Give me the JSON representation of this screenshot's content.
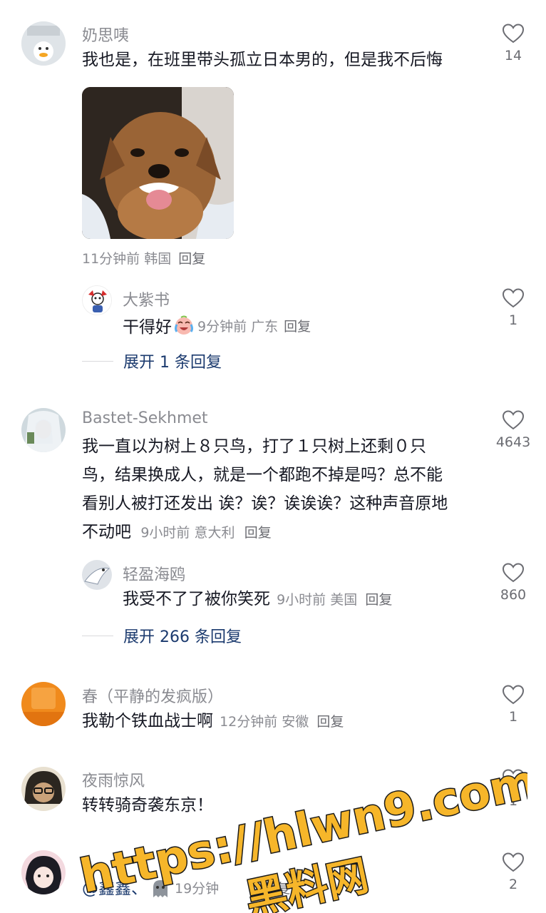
{
  "comments": [
    {
      "username": "奶思咦",
      "text": "我也是，在班里带头孤立日本男的，但是我不后悔",
      "meta": "11分钟前 韩国",
      "reply_label": "回复",
      "likes": "14",
      "sticker": "grinning-dog-sticker",
      "replies": [
        {
          "username": "大紫书",
          "text": "干得好",
          "emoji": "crying-laughing-emoji",
          "meta": "9分钟前 广东",
          "reply_label": "回复",
          "likes": "1"
        }
      ],
      "expand_label": "展开 1 条回复"
    },
    {
      "username": "Bastet-Sekhmet",
      "text_lines": [
        "我一直以为树上８只鸟，打了１只树上还剩０只",
        "鸟，结果换成人，就是一个都跑不掉是吗？总不能",
        "看别人被打还发出 诶？诶？诶诶诶？这种声音原地",
        "不动吧"
      ],
      "meta": "9小时前 意大利",
      "reply_label": "回复",
      "likes": "4643",
      "replies": [
        {
          "username": "轻盈海鸥",
          "text": "我受不了了被你笑死",
          "meta": "9小时前 美国",
          "reply_label": "回复",
          "likes": "860"
        }
      ],
      "expand_label": "展开 266 条回复"
    },
    {
      "username": "春（平静的发疯版）",
      "text": "我勒个铁血战士啊",
      "meta": "12分钟前 安徽",
      "reply_label": "回复",
      "likes": "1"
    },
    {
      "username": "夜雨惊风",
      "text": "转转骑奇袭东京！",
      "likes": "1"
    },
    {
      "mention": "@鑫鑫、",
      "meta": "19分钟",
      "reply_label": "回复",
      "likes": "2"
    }
  ],
  "watermark": {
    "url": "https://hlwn9.com",
    "name": "黑料网"
  },
  "colors": {
    "text": "#161823",
    "muted": "#8a8b91",
    "link": "#1b3a6e",
    "watermark": "#f6b62a"
  }
}
